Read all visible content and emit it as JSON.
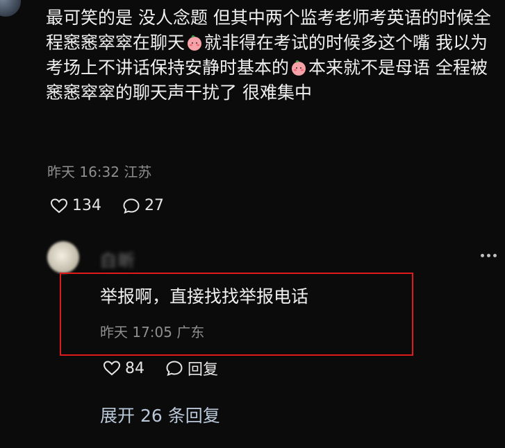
{
  "comment": {
    "segments": [
      "最可笑的是 没人念题 但其中两个监考老师考英语的时候全程窸窸窣窣在聊天",
      "就非得在考试的时候多这个嘴 我以为考场上不讲话保持安静时基本的",
      "本来就不是母语 全程被窸窸窣窣的聊天声干扰了 很难集中"
    ],
    "emoji_icon": "peach-face-emoji",
    "time": "昨天 16:32",
    "location": "江苏",
    "likes": "134",
    "comments": "27"
  },
  "reply": {
    "username": "白昕",
    "text": "举报啊，直接找找举报电话",
    "time": "昨天 17:05",
    "location": "广东",
    "likes": "84",
    "reply_label": "回复"
  },
  "expand": {
    "label": "展开 26 条回复"
  },
  "colors": {
    "background": "#0b0b0b",
    "highlight": "#e01a1a",
    "meta": "#8f8f8f",
    "expand": "#b9c7d8"
  }
}
